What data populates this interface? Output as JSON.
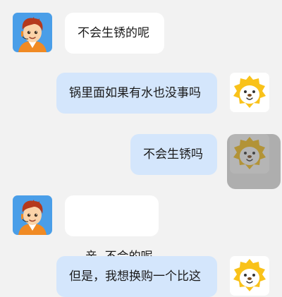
{
  "messages": [
    {
      "side": "left",
      "text": "不会生锈的呢",
      "avatar": "boy-avatar-icon"
    },
    {
      "side": "right",
      "text": "锅里面如果有水也没事吗",
      "avatar": "lion-mascot-icon"
    },
    {
      "side": "right",
      "text": "不会生锈吗",
      "avatar": "lion-mascot-icon"
    },
    {
      "side": "left",
      "text": "亲  不会的呢",
      "avatar": "boy-avatar-icon"
    },
    {
      "side": "right",
      "text": "但是，我想换购一个比这",
      "avatar": "lion-mascot-icon"
    }
  ],
  "colors": {
    "background": "#f2f2f2",
    "left_bubble": "#ffffff",
    "right_bubble": "#d4e6fc",
    "avatar_left_bg": "#4a9ee8",
    "lion_yellow": "#f9c21a"
  }
}
